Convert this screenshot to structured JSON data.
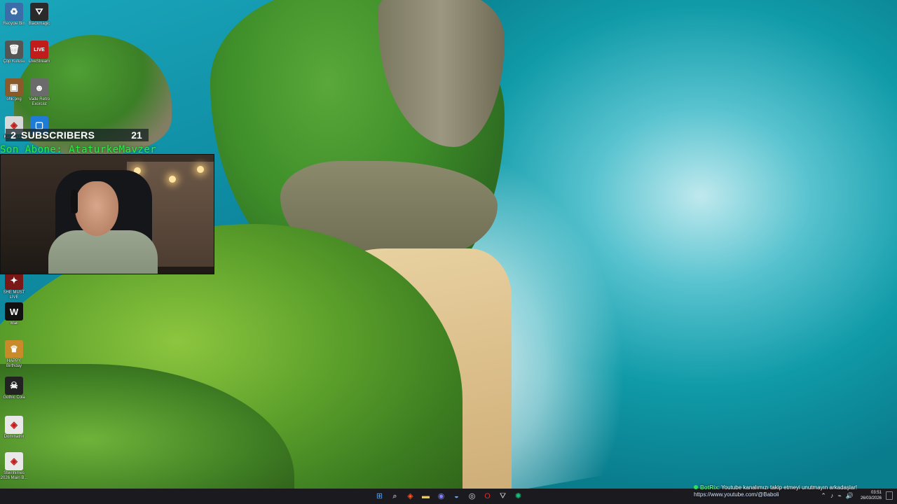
{
  "desktop_icons": [
    {
      "label": "Recycle Bin",
      "glyph": "♻",
      "color": "#3b6ea8"
    },
    {
      "label": "Blackmagic",
      "glyph": "⛛",
      "color": "#2a2a2a"
    },
    {
      "label": "Çöp Kutusu",
      "glyph": "🗑",
      "color": "#555555"
    },
    {
      "label": "LiveStream",
      "glyph": "LIVE",
      "color": "#c21b1b"
    },
    {
      "label": "ohk.png",
      "glyph": "▣",
      "color": "#8a5a2b"
    },
    {
      "label": "Vade Retro Exorcist",
      "glyph": "☻",
      "color": "#6b6b6b"
    },
    {
      "label": "Karabudak",
      "glyph": "◈",
      "color": "#d8d8d8"
    },
    {
      "label": "",
      "glyph": "▢",
      "color": "#1e7bd6"
    },
    {
      "label": "SHE MUST LIVE",
      "glyph": "✦",
      "color": "#7a1717"
    },
    {
      "label": "Wail",
      "glyph": "W",
      "color": "#111111"
    },
    {
      "label": "HAPPY Birthday",
      "glyph": "♛",
      "color": "#c98b2a"
    },
    {
      "label": "Gothic Cola",
      "glyph": "☠",
      "color": "#222222"
    },
    {
      "label": "Dominatrix",
      "glyph": "◈",
      "color": "#e8e8e8"
    },
    {
      "label": "Steinhimes 2026 Main B...",
      "glyph": "◈",
      "color": "#e8e8e8"
    }
  ],
  "stream_overlay": {
    "subscribers_left": "2",
    "subscribers_label": "SUBSCRIBERS",
    "subscribers_right": "21",
    "last_subscriber": "Son Abone: AtaturkeMavzer"
  },
  "chat_overlay": {
    "bot_name": "BotRix",
    "message": ": Youtube kanalımızı takip etmeyi unutmayın arkadaşlar!",
    "url": "https://www.youtube.com/@Baboli"
  },
  "taskbar": {
    "apps": [
      {
        "name": "start-button",
        "glyph": "⊞",
        "color": "#4aa3ff"
      },
      {
        "name": "search-button",
        "glyph": "⌕",
        "color": "#ffffff"
      },
      {
        "name": "brave-browser-button",
        "glyph": "◈",
        "color": "#ff5a2a"
      },
      {
        "name": "file-explorer-button",
        "glyph": "▬",
        "color": "#f2c94c"
      },
      {
        "name": "discord-button",
        "glyph": "◉",
        "color": "#7d7dff"
      },
      {
        "name": "steam-button",
        "glyph": "◒",
        "color": "#6aa8ff"
      },
      {
        "name": "obs-button",
        "glyph": "◎",
        "color": "#dddddd"
      },
      {
        "name": "opera-button",
        "glyph": "O",
        "color": "#e02a2a"
      },
      {
        "name": "app-button",
        "glyph": "⛛",
        "color": "#cccccc"
      },
      {
        "name": "chatgpt-button",
        "glyph": "✺",
        "color": "#19c37d"
      }
    ],
    "tray_icons": [
      "⌃",
      "♪",
      "⌁",
      "🔊"
    ],
    "time": "03:51",
    "date": "26/03/2026"
  }
}
